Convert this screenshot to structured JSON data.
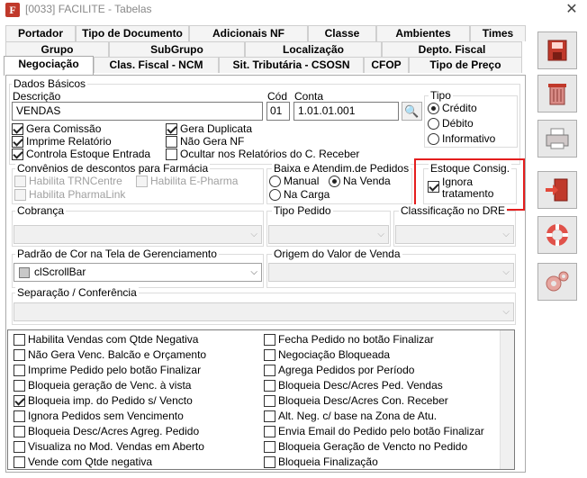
{
  "window": {
    "title": "[0033] FACILITE - Tabelas",
    "app_icon_letter": "F",
    "close_glyph": "✕"
  },
  "tabs_row1": [
    "Portador",
    "Tipo de Documento",
    "Adicionais NF",
    "Classe",
    "Ambientes",
    "Times"
  ],
  "tabs_row2": [
    "Grupo",
    "SubGrupo",
    "Localização",
    "Depto. Fiscal"
  ],
  "tabs_row3": [
    "Negociação",
    "Clas. Fiscal - NCM",
    "Sit. Tributária - CSOSN",
    "CFOP",
    "Tipo de Preço"
  ],
  "dados": {
    "group_label": "Dados Básicos",
    "descricao_label": "Descrição",
    "descricao_value": "VENDAS",
    "cod_label": "Cód",
    "cod_value": "01",
    "conta_label": "Conta",
    "conta_value": "1.01.01.001",
    "tipo_label": "Tipo",
    "tipo_options": [
      "Crédito",
      "Débito",
      "Informativo"
    ],
    "checks": [
      {
        "label": "Gera Comissão",
        "checked": true
      },
      {
        "label": "Imprime Relatório",
        "checked": true
      },
      {
        "label": "Controla Estoque Entrada",
        "checked": true
      },
      {
        "label": "Gera Duplicata",
        "checked": true
      },
      {
        "label": "Não Gera NF",
        "checked": false
      },
      {
        "label": "Ocultar nos Relatórios do C. Receber",
        "checked": false
      }
    ]
  },
  "convenios": {
    "label": "Convênios de descontos para Farmácia",
    "items": [
      "Habilita TRNCentre",
      "Habilita E-Pharma",
      "Habilita PharmaLink"
    ]
  },
  "baixa": {
    "label": "Baixa e Atendim.de Pedidos",
    "options": [
      "Manual",
      "Na Venda",
      "Na Carga"
    ],
    "selected": "Na Venda"
  },
  "estoque": {
    "label": "Estoque Consig.",
    "check_label_1": "Ignora",
    "check_label_2": "tratamento",
    "checked": true
  },
  "cobranca_label": "Cobrança",
  "tipo_pedido_label": "Tipo Pedido",
  "classificacao_label": "Classificação no DRE",
  "padrao_cor_label": "Padrão de Cor na Tela de Gerenciamento",
  "padrao_cor_value": "clScrollBar",
  "origem_valor_label": "Origem do Valor de Venda",
  "separacao_label": "Separação / Conferência",
  "options_left": [
    {
      "label": "Habilita Vendas com Qtde Negativa",
      "checked": false
    },
    {
      "label": "Não Gera Venc. Balcão e Orçamento",
      "checked": false
    },
    {
      "label": "Imprime Pedido pelo botão Finalizar",
      "checked": false
    },
    {
      "label": "Bloqueia geração de Venc. à vista",
      "checked": false
    },
    {
      "label": "Bloqueia imp. do Pedido s/ Vencto",
      "checked": true
    },
    {
      "label": "Ignora Pedidos sem Vencimento",
      "checked": false
    },
    {
      "label": "Bloqueia Desc/Acres Agreg. Pedido",
      "checked": false
    },
    {
      "label": "Visualiza no Mod. Vendas em Aberto",
      "checked": false
    },
    {
      "label": "Vende com Qtde negativa",
      "checked": false
    }
  ],
  "options_right": [
    {
      "label": "Fecha Pedido no botão Finalizar",
      "checked": false
    },
    {
      "label": "Negociação Bloqueada",
      "checked": false
    },
    {
      "label": "Agrega Pedidos por Período",
      "checked": false
    },
    {
      "label": "Bloqueia Desc/Acres Ped. Vendas",
      "checked": false
    },
    {
      "label": "Bloqueia Desc/Acres Con. Receber",
      "checked": false
    },
    {
      "label": "Alt. Neg. c/ base na Zona de Atu.",
      "checked": false
    },
    {
      "label": "Envia Email do Pedido pelo botão Finalizar",
      "checked": false
    },
    {
      "label": "Bloqueia Geração de Vencto no Pedido",
      "checked": false
    },
    {
      "label": "Bloqueia Finalização",
      "checked": false
    }
  ],
  "side_icons": [
    "save-icon",
    "trash-icon",
    "print-icon",
    "exit-door-icon",
    "lifebuoy-icon",
    "gears-icon"
  ],
  "colors": {
    "highlight_border": "#e41e1e"
  }
}
